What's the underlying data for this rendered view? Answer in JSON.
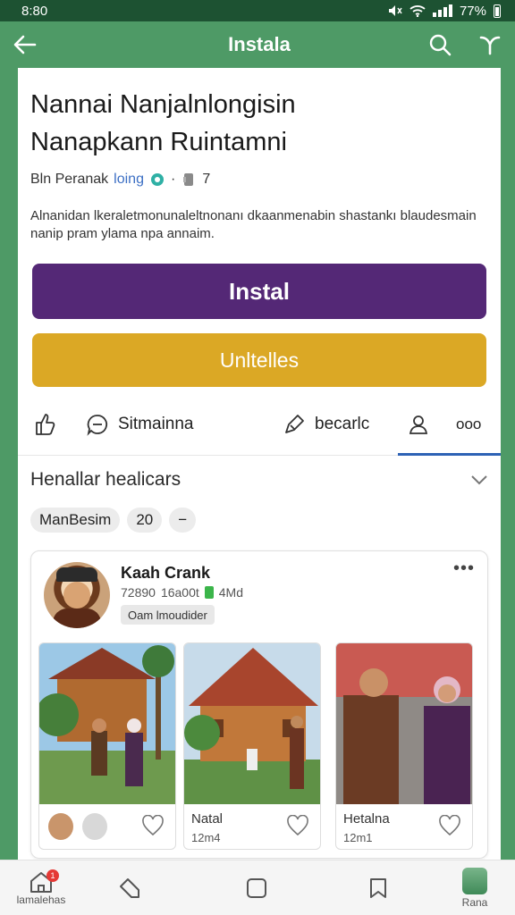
{
  "status_bar": {
    "time": "8:80",
    "battery": "77%"
  },
  "app_bar": {
    "title": "Instala"
  },
  "app": {
    "title_line1": "Nannai Nanjalnlongisin",
    "title_line2": "Nanapkann Ruintamni",
    "developer": "Bln Peranak",
    "developer_accent": "loing",
    "rating_sep": "·",
    "count": "7",
    "description": "Alnanidan lkeraletmonunaleltnonanı dkaanmenabin shastankı blaudesmain nanip pram ylama npa annaim."
  },
  "buttons": {
    "install": "Instal",
    "updates": "Unltelles"
  },
  "actions": {
    "share_label": "Sitmainna",
    "review_label": "becarlc",
    "more_label": "ooo"
  },
  "section": {
    "title": "Henallar healicars"
  },
  "chips": [
    "ManBesim",
    "20",
    "−"
  ],
  "post": {
    "name": "Kaah Crank",
    "meta_a": "72890",
    "meta_b": "16a00t",
    "meta_c": "4Md",
    "tag": "Oam lmoudider",
    "more": "•••",
    "photos": [
      {
        "caption": "",
        "sub": ""
      },
      {
        "caption": "Natal",
        "sub": "12m4"
      },
      {
        "caption": "Hetalna",
        "sub": "12m1"
      }
    ]
  },
  "bottom_nav": {
    "home_label": "lamalehas",
    "badge": "1",
    "profile_label": "Rana"
  },
  "colors": {
    "brand_green": "#4e9a66",
    "install_purple": "#542876",
    "updates_gold": "#dba825",
    "accent_blue": "#2d62b5"
  }
}
